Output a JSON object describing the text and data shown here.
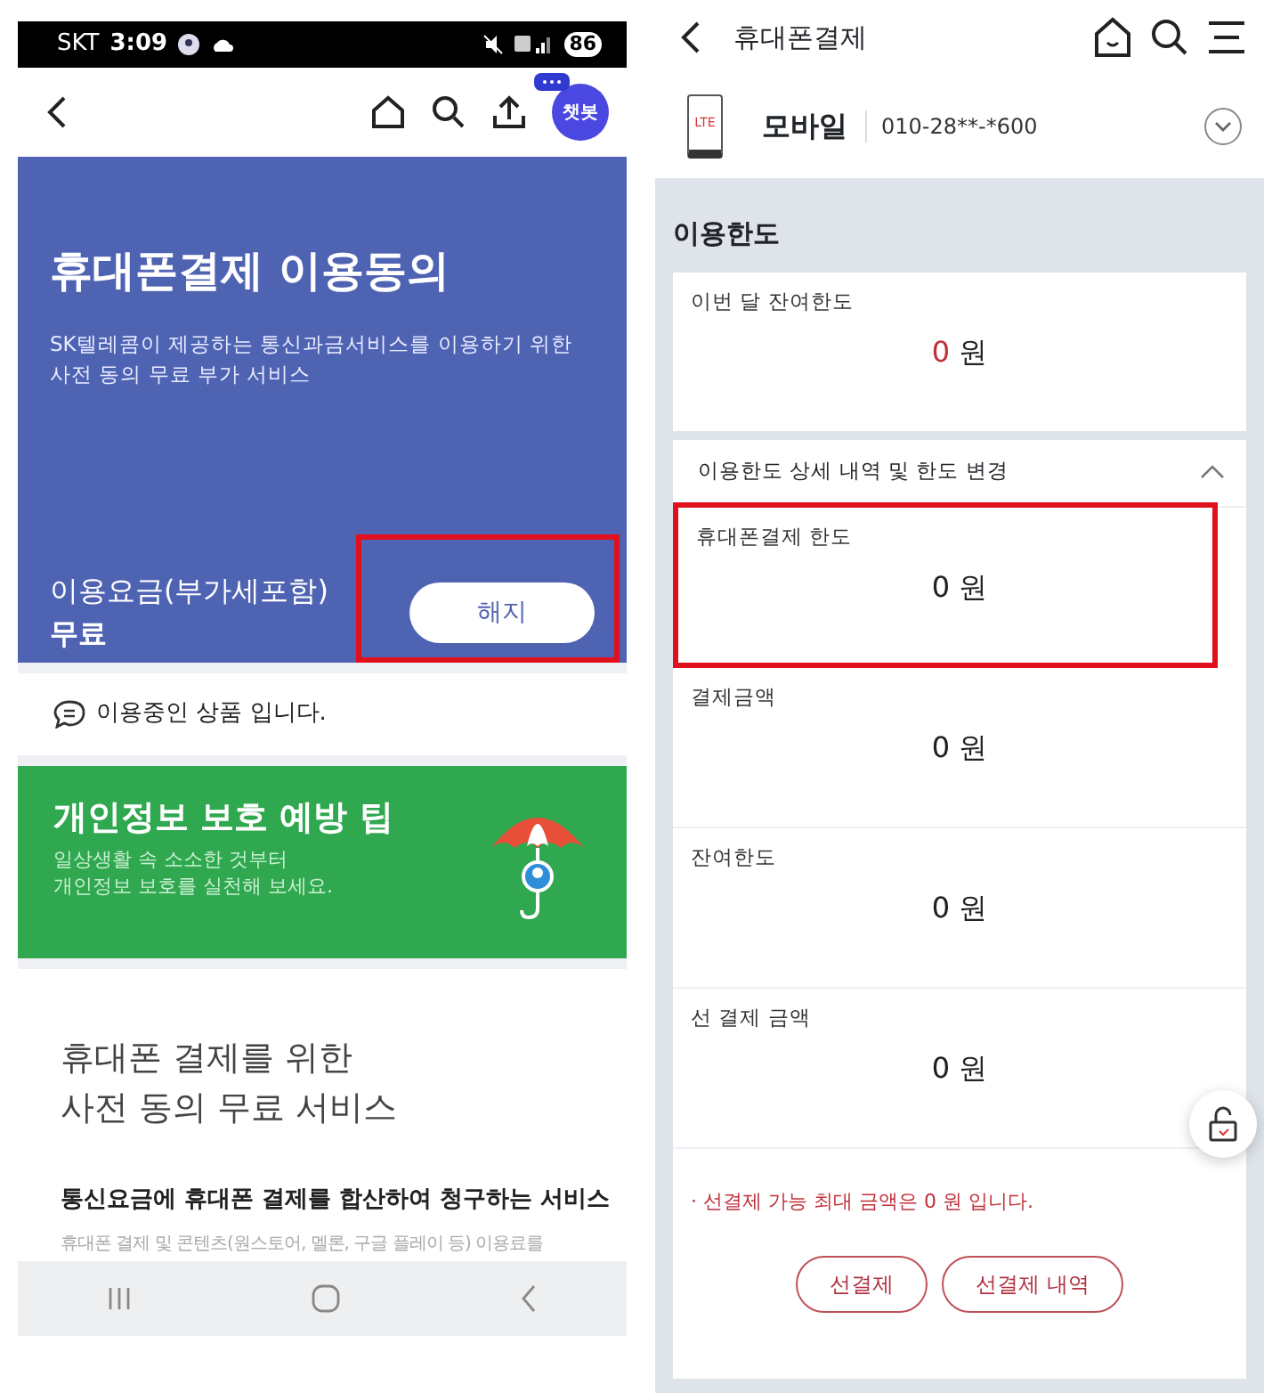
{
  "left_screen": {
    "status_bar": {
      "carrier": "SKT",
      "time": "3:09",
      "battery": "86"
    },
    "chatbot_badge": "챗봇",
    "hero": {
      "title": "휴대폰결제 이용동의",
      "description": "SK텔레콤이 제공하는 통신과금서비스를 이용하기 위한 사전 동의 무료 부가 서비스",
      "fee_label": "이용요금(부가세포함)",
      "fee_value": "무료",
      "button": {
        "label": "해지",
        "highlighted": true
      }
    },
    "notice": "이용중인 상품 입니다.",
    "banner": {
      "title": "개인정보 보호 예방 팁",
      "lines": [
        "일상생활 속 소소한 것부터",
        "개인정보 보호를 실천해 보세요."
      ]
    },
    "intro": {
      "heading_lines": [
        "휴대폰 결제를 위한",
        "사전 동의 무료 서비스"
      ],
      "subheading": "통신요금에 휴대폰 결제를 합산하여 청구하는 서비스",
      "body": "휴대폰 결제 및 콘텐츠(원스토어, 멜론, 구글 플레이 등) 이용료를"
    }
  },
  "right_screen": {
    "title": "휴대폰결제",
    "account": {
      "badge": "LTE",
      "type": "모바일",
      "number": "010-28**-*600"
    },
    "section_title": "이용한도",
    "monthly": {
      "label": "이번 달 잔여한도",
      "amount": "0",
      "unit": "원"
    },
    "details": {
      "title": "이용한도 상세 내역 및 한도 변경",
      "expanded": true,
      "items": [
        {
          "label": "휴대폰결제 한도",
          "amount": "0",
          "unit": "원",
          "highlighted": true
        },
        {
          "label": "결제금액",
          "amount": "0",
          "unit": "원",
          "highlighted": false
        },
        {
          "label": "잔여한도",
          "amount": "0",
          "unit": "원",
          "highlighted": false
        },
        {
          "label": "선 결제 금액",
          "amount": "0",
          "unit": "원",
          "highlighted": false
        }
      ]
    },
    "note": "· 선결제 가능 최대 금액은 0 원 입니다.",
    "buttons": [
      "선결제",
      "선결제 내역"
    ]
  }
}
